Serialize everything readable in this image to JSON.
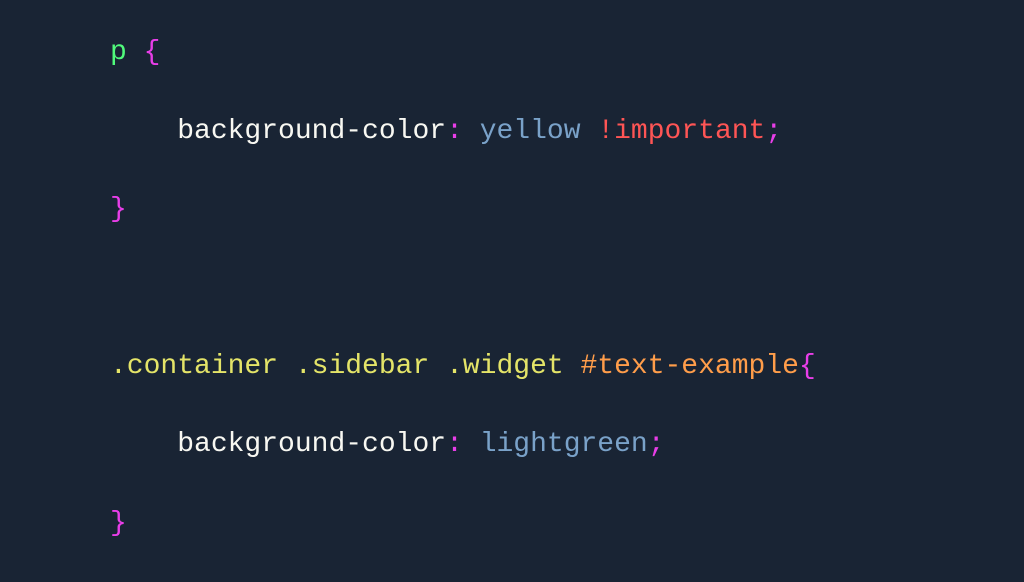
{
  "code": {
    "rule1": {
      "selector": "p",
      "brace_open": " {",
      "indent": "    ",
      "property": "background-color",
      "colon": ":",
      "space": " ",
      "value": "yellow",
      "important": " !important",
      "semicolon": ";",
      "brace_close": "}"
    },
    "rule2": {
      "sel_class1": ".container",
      "sel_class2": " .sidebar",
      "sel_class3": " .widget",
      "sel_id": " #text-example",
      "brace_open": "{",
      "indent": "    ",
      "property": "background-color",
      "colon": ":",
      "space": " ",
      "value": "lightgreen",
      "semicolon": ";",
      "brace_close": "}"
    }
  }
}
